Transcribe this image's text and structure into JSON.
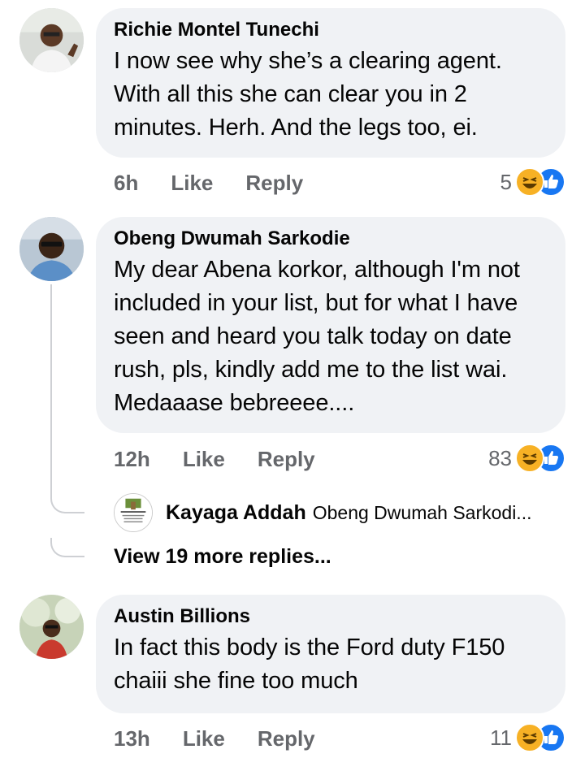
{
  "comments": [
    {
      "author": "Richie Montel Tunechi",
      "text": "I now see why she’s a clearing agent. With all this she can clear you in 2 minutes. Herh. And the legs too, ei.",
      "time": "6h",
      "like_label": "Like",
      "reply_label": "Reply",
      "reactions": "5"
    },
    {
      "author": "Obeng Dwumah Sarkodie",
      "text": "My dear Abena korkor, although I'm not included in your list, but for what I have seen and heard you talk today on date rush, pls, kindly add me to the list wai. Medaaase bebreeee....",
      "time": "12h",
      "like_label": "Like",
      "reply_label": "Reply",
      "reactions": "83",
      "reply_preview": {
        "author": "Kayaga Addah",
        "text": "Obeng Dwumah Sarkodi..."
      },
      "more_replies": "View 19 more replies..."
    },
    {
      "author": "Austin Billions",
      "text": "In fact this body is the Ford duty F150 chaiii she fine too much",
      "time": "13h",
      "like_label": "Like",
      "reply_label": "Reply",
      "reactions": "11"
    }
  ],
  "icons": {
    "haha": "haha-reaction-icon",
    "like": "like-reaction-icon"
  },
  "colors": {
    "bubble": "#f0f2f5",
    "meta": "#65676b",
    "haha": "#f7b125",
    "like": "#1877f2"
  }
}
